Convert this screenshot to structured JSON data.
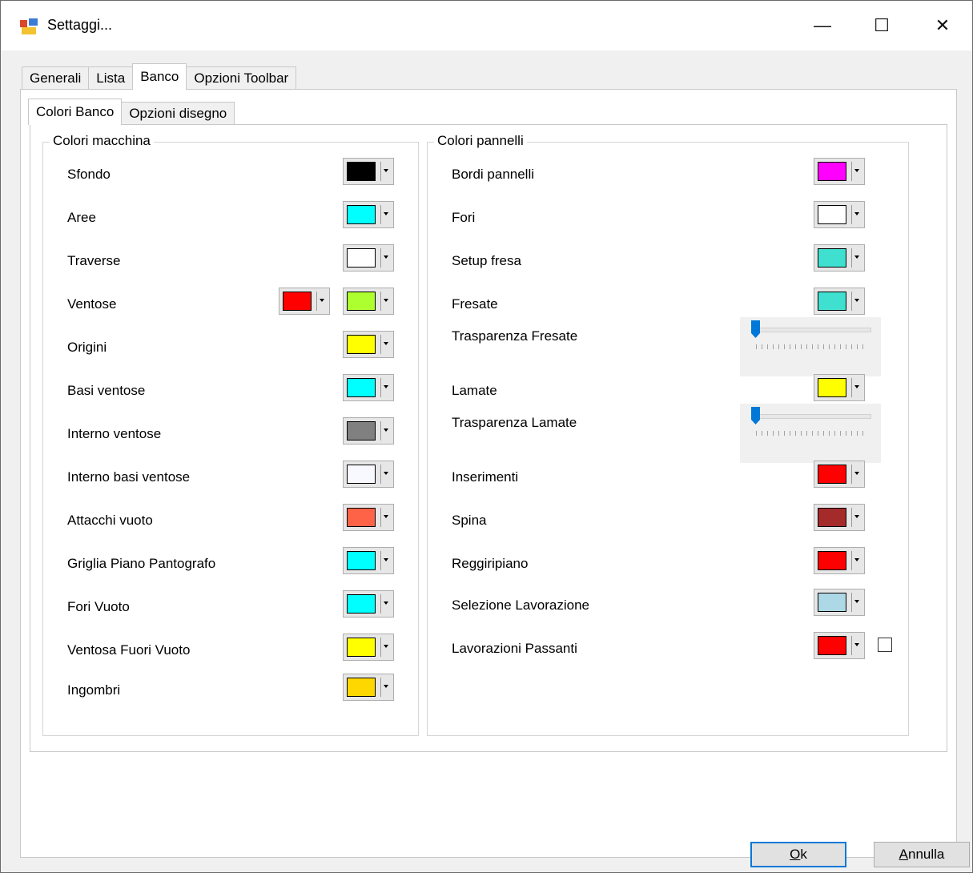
{
  "window": {
    "title": "Settaggi...",
    "min_glyph": "—",
    "max_glyph": "☐",
    "close_glyph": "✕"
  },
  "tabs": [
    "Generali",
    "Lista",
    "Banco",
    "Opzioni Toolbar"
  ],
  "active_tab": "Banco",
  "subtabs": [
    "Colori Banco",
    "Opzioni disegno"
  ],
  "active_subtab": "Colori Banco",
  "left_group": {
    "title": "Colori macchina",
    "items": [
      {
        "label": "Sfondo",
        "color": "#000000"
      },
      {
        "label": "Aree",
        "color": "#00ffff"
      },
      {
        "label": "Traverse",
        "color": "#ffffff"
      },
      {
        "label": "Ventose",
        "color": "#adff2f",
        "extra_color": "#ff0000"
      },
      {
        "label": "Origini",
        "color": "#ffff00"
      },
      {
        "label": "Basi ventose",
        "color": "#00ffff"
      },
      {
        "label": "Interno ventose",
        "color": "#808080"
      },
      {
        "label": "Interno basi ventose",
        "color": "#f8f8ff"
      },
      {
        "label": "Attacchi vuoto",
        "color": "#ff6347"
      },
      {
        "label": "Griglia Piano Pantografo",
        "color": "#00ffff"
      },
      {
        "label": "Fori Vuoto",
        "color": "#00ffff"
      },
      {
        "label": "Ventosa Fuori Vuoto",
        "color": "#ffff00"
      },
      {
        "label": "Ingombri",
        "color": "#ffd700"
      }
    ]
  },
  "right_group": {
    "title": "Colori pannelli",
    "items": [
      {
        "label": "Bordi pannelli",
        "color": "#ff00ff"
      },
      {
        "label": "Fori",
        "color": "#ffffff"
      },
      {
        "label": "Setup fresa",
        "color": "#40e0d0"
      },
      {
        "label": "Fresate",
        "color": "#40e0d0"
      },
      {
        "label": "Trasparenza Fresate",
        "slider_value": 0
      },
      {
        "label": "Lamate",
        "color": "#ffff00"
      },
      {
        "label": "Trasparenza Lamate",
        "slider_value": 0
      },
      {
        "label": "Inserimenti",
        "color": "#ff0000"
      },
      {
        "label": "Spina",
        "color": "#a52a2a"
      },
      {
        "label": "Reggiripiano",
        "color": "#ff0000"
      },
      {
        "label": "Selezione Lavorazione",
        "color": "#add8e6"
      },
      {
        "label": "Lavorazioni Passanti",
        "color": "#ff0000",
        "checked": false
      }
    ]
  },
  "buttons": {
    "ok_mnemonic": "O",
    "ok_rest": "k",
    "cancel_mnemonic": "A",
    "cancel_rest": "nnulla"
  }
}
